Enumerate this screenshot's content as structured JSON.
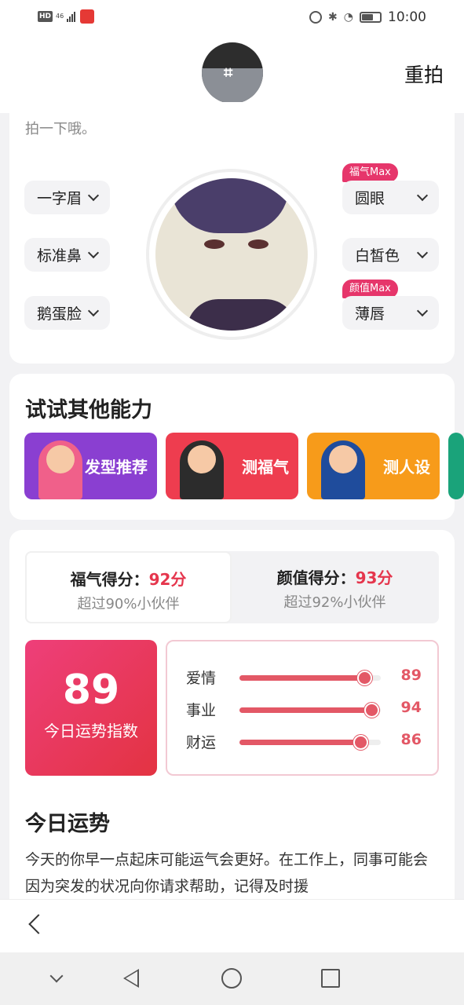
{
  "status_bar": {
    "hd": "HD",
    "network": "46",
    "time": "10:00"
  },
  "header": {
    "retake_label": "重拍"
  },
  "features": {
    "hint": "拍一下哦。",
    "left": [
      "一字眉",
      "标准鼻",
      "鹅蛋脸"
    ],
    "right": [
      "圆眼",
      "白皙色",
      "薄唇"
    ],
    "tags": {
      "eyes": "福气Max",
      "lips": "颜值Max"
    }
  },
  "abilities": {
    "title": "试试其他能力",
    "items": [
      {
        "label": "发型推荐",
        "color": "#8a3fd1"
      },
      {
        "label": "测福气",
        "color": "#ee3d4f"
      },
      {
        "label": "测人设",
        "color": "#f79b1a"
      }
    ]
  },
  "scores": {
    "luck": {
      "label": "福气得分：",
      "value": "92分",
      "sub": "超过90%小伙伴"
    },
    "looks": {
      "label": "颜值得分：",
      "value": "93分",
      "sub": "超过92%小伙伴"
    }
  },
  "fortune": {
    "index": "89",
    "index_label": "今日运势指数",
    "metrics": [
      {
        "label": "爱情",
        "value": "89",
        "fraction": 0.89,
        "icon": "heart-icon"
      },
      {
        "label": "事业",
        "value": "94",
        "fraction": 0.94,
        "icon": "briefcase-icon"
      },
      {
        "label": "财运",
        "value": "86",
        "fraction": 0.86,
        "icon": "diamond-icon"
      }
    ],
    "title": "今日运势",
    "text": "今天的你早一点起床可能运气会更好。在工作上，同事可能会因为突发的状况向你请求帮助，记得及时援"
  },
  "colors": {
    "accent": "#e5364d",
    "tag": "#e6366b"
  }
}
